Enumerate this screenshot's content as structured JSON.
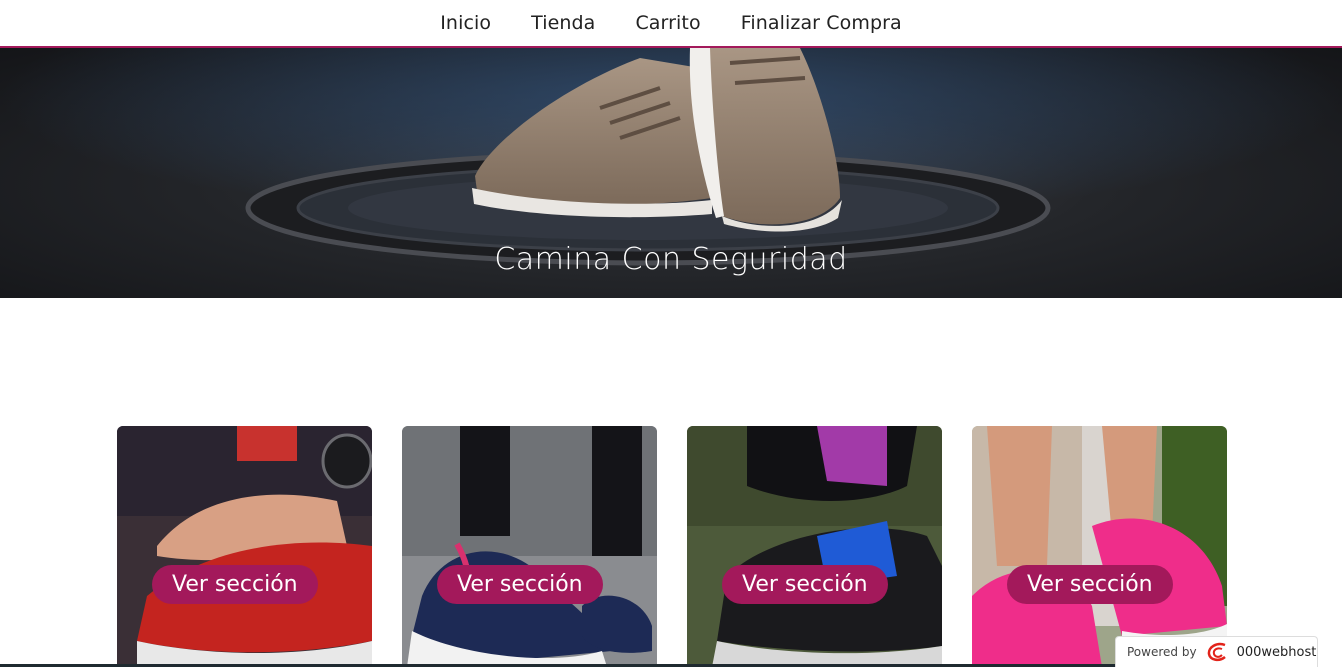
{
  "nav": {
    "items": [
      {
        "label": "Inicio"
      },
      {
        "label": "Tienda"
      },
      {
        "label": "Carrito"
      },
      {
        "label": "Finalizar Compra"
      }
    ]
  },
  "hero": {
    "title": "Camina Con Seguridad"
  },
  "cards": [
    {
      "button_label": "Ver sección",
      "image": "red-sneaker-lacing-photo"
    },
    {
      "button_label": "Ver sección",
      "image": "navy-sneaker-photo"
    },
    {
      "button_label": "Ver sección",
      "image": "black-blue-sneaker-photo"
    },
    {
      "button_label": "Ver sección",
      "image": "pink-sneaker-photo"
    }
  ],
  "footer_badge": {
    "powered_label": "Powered by",
    "brand": "000webhost"
  },
  "colors": {
    "accent": "#a3195b",
    "nav_text": "#222222"
  }
}
